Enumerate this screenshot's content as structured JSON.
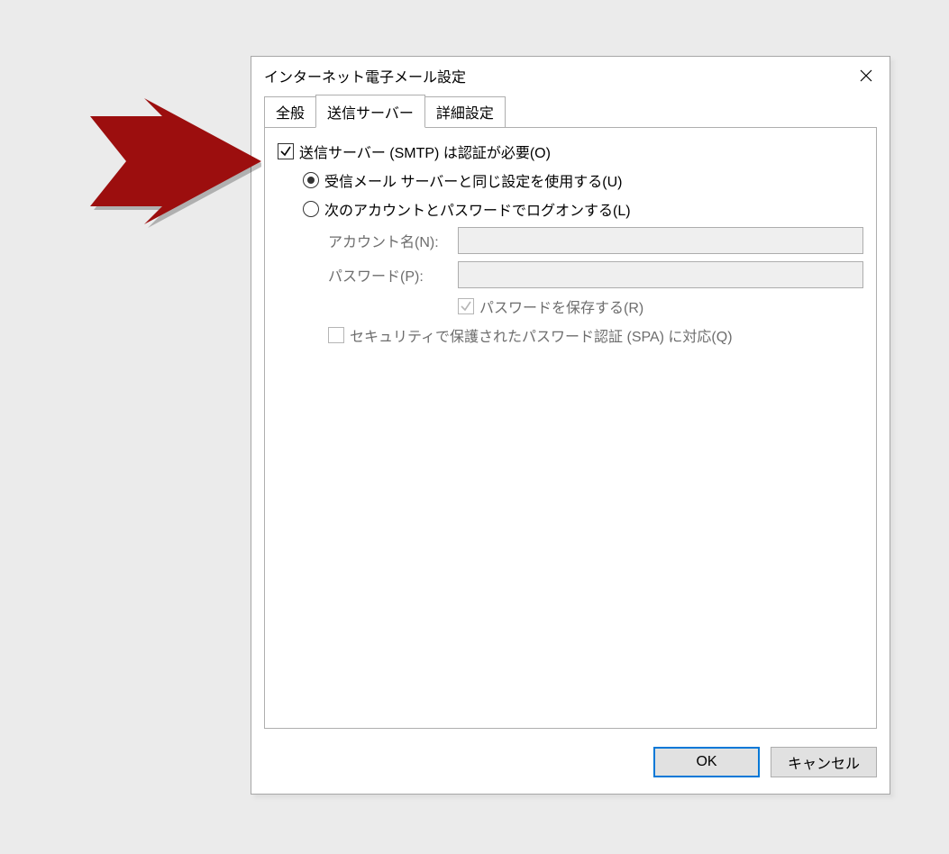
{
  "dialog": {
    "title": "インターネット電子メール設定",
    "tabs": {
      "general": "全般",
      "outgoing": "送信サーバー",
      "advanced": "詳細設定"
    },
    "outgoing": {
      "smtp_auth_required": "送信サーバー (SMTP) は認証が必要(O)",
      "use_same_as_incoming": "受信メール サーバーと同じ設定を使用する(U)",
      "logon_with_account": "次のアカウントとパスワードでログオンする(L)",
      "account_name_label": "アカウント名(N):",
      "password_label": "パスワード(P):",
      "remember_password": "パスワードを保存する(R)",
      "spa_support": "セキュリティで保護されたパスワード認証 (SPA) に対応(Q)"
    },
    "buttons": {
      "ok": "OK",
      "cancel": "キャンセル"
    }
  }
}
